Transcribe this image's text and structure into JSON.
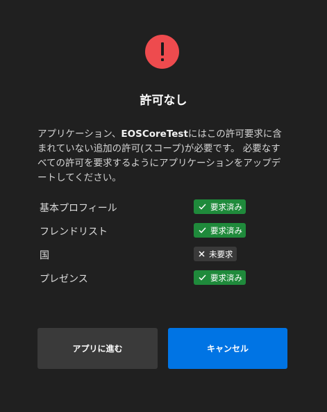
{
  "dialog": {
    "title": "許可なし",
    "message_pre": "アプリケーション、",
    "app_name": "EOSCoreTest",
    "message_post": "にはこの許可要求に含まれていない追加の許可(スコープ)が必要です。 必要なすべての許可を要求するようにアプリケーションをアップデートしてください。",
    "icon": "exclamation-circle-icon",
    "accent_color": "#ee4b4e"
  },
  "permissions": [
    {
      "label": "基本プロフィール",
      "status": "要求済み",
      "state": "granted"
    },
    {
      "label": "フレンドリスト",
      "status": "要求済み",
      "state": "granted"
    },
    {
      "label": "国",
      "status": "未要求",
      "state": "denied"
    },
    {
      "label": "プレゼンス",
      "status": "要求済み",
      "state": "granted"
    }
  ],
  "colors": {
    "granted": "#1f8a3b",
    "denied": "#3a3a3a",
    "primary_button": "#0074e4",
    "secondary_button": "#3a3a3a"
  },
  "buttons": {
    "proceed_label": "アプリに進む",
    "cancel_label": "キャンセル"
  }
}
